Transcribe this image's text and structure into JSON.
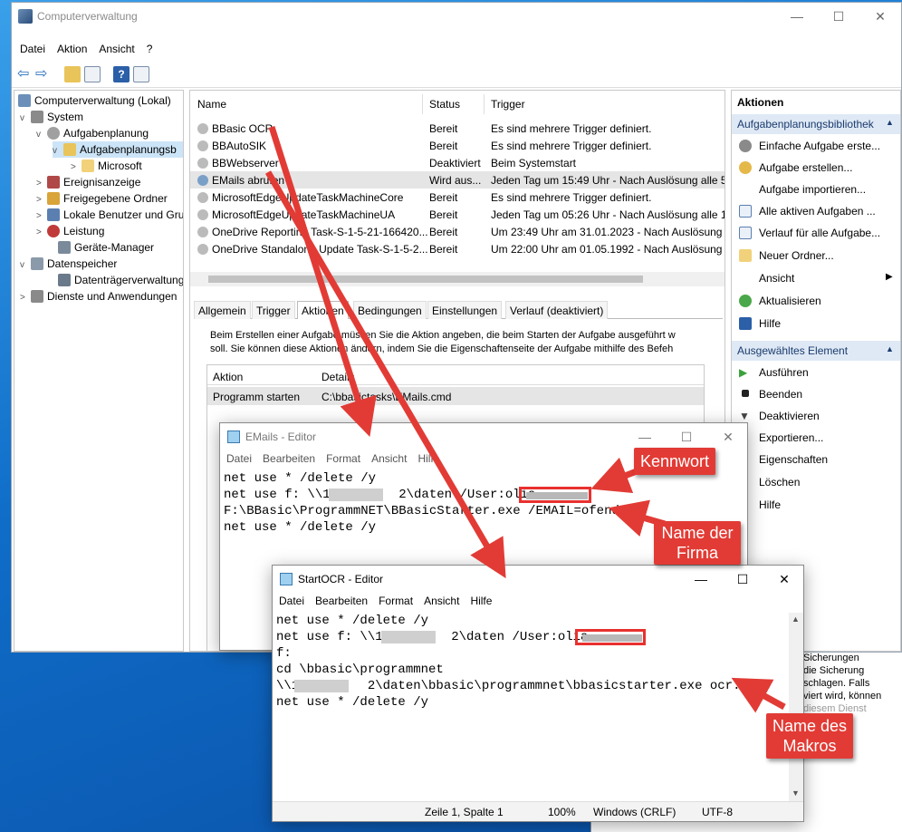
{
  "main": {
    "title": "Computerverwaltung",
    "controls": {
      "minimize": "—",
      "maximize": "☐",
      "close": "✕"
    },
    "menu": [
      "Datei",
      "Aktion",
      "Ansicht",
      "?"
    ]
  },
  "tree": [
    {
      "label": "Computerverwaltung (Lokal)",
      "exp": ""
    },
    {
      "label": "System",
      "exp": "v"
    },
    {
      "label": "Aufgabenplanung",
      "exp": "v"
    },
    {
      "label": "Aufgabenplanungsb",
      "exp": "v"
    },
    {
      "label": "Microsoft",
      "exp": ">"
    },
    {
      "label": "Ereignisanzeige",
      "exp": ">"
    },
    {
      "label": "Freigegebene Ordner",
      "exp": ">"
    },
    {
      "label": "Lokale Benutzer und Gru",
      "exp": ">"
    },
    {
      "label": "Leistung",
      "exp": ">"
    },
    {
      "label": "Geräte-Manager",
      "exp": ""
    },
    {
      "label": "Datenspeicher",
      "exp": "v"
    },
    {
      "label": "Datenträgerverwaltung",
      "exp": ""
    },
    {
      "label": "Dienste und Anwendungen",
      "exp": ">"
    }
  ],
  "tasks": {
    "columns": [
      "Name",
      "Status",
      "Trigger"
    ],
    "rows": [
      {
        "name": "BBasic OCR",
        "status": "Bereit",
        "trigger": "Es sind mehrere Trigger definiert."
      },
      {
        "name": "BBAutoSIK",
        "status": "Bereit",
        "trigger": "Es sind mehrere Trigger definiert."
      },
      {
        "name": "BBWebserver",
        "status": "Deaktiviert",
        "trigger": "Beim Systemstart"
      },
      {
        "name": "EMails abrufen",
        "status": "Wird aus...",
        "trigger": "Jeden Tag um 15:49 Uhr - Nach Auslösung alle 5"
      },
      {
        "name": "MicrosoftEdgeUpdateTaskMachineCore",
        "status": "Bereit",
        "trigger": "Es sind mehrere Trigger definiert."
      },
      {
        "name": "MicrosoftEdgeUpdateTaskMachineUA",
        "status": "Bereit",
        "trigger": "Jeden Tag um 05:26 Uhr - Nach Auslösung alle 1"
      },
      {
        "name": "OneDrive Reporting Task-S-1-5-21-166420...",
        "status": "Bereit",
        "trigger": "Um 23:49 Uhr am 31.01.2023 - Nach Auslösung a"
      },
      {
        "name": "OneDrive Standalone Update Task-S-1-5-2...",
        "status": "Bereit",
        "trigger": "Um 22:00 Uhr am 01.05.1992 - Nach Auslösung a"
      }
    ]
  },
  "detail_tabs": [
    "Allgemein",
    "Trigger",
    "Aktionen",
    "Bedingungen",
    "Einstellungen",
    "Verlauf (deaktiviert)"
  ],
  "detail": {
    "text1": "Beim Erstellen einer Aufgabe müssen Sie die Aktion angeben, die beim Starten der Aufgabe ausgeführt w",
    "text2": "soll. Sie können diese Aktionen ändern, indem Sie die Eigenschaftenseite der Aufgabe mithilfe des Befeh",
    "col_action": "Aktion",
    "col_details": "Details",
    "row_action": "Programm starten",
    "row_details": "C:\\bbasictasks\\EMails.cmd"
  },
  "actions_pane": {
    "header": "Aktionen",
    "section1": "Aufgabenplanungsbibliothek",
    "items1": [
      "Einfache Aufgabe erste...",
      "Aufgabe erstellen...",
      "Aufgabe importieren...",
      "Alle aktiven Aufgaben ...",
      "Verlauf für alle Aufgabe...",
      "Neuer Ordner...",
      "Ansicht",
      "Aktualisieren",
      "Hilfe"
    ],
    "section2": "Ausgewähltes Element",
    "items2": [
      "Ausführen",
      "Beenden",
      "Deaktivieren",
      "Exportieren...",
      "Eigenschaften",
      "Löschen",
      "Hilfe"
    ]
  },
  "behind_text": [
    "Sicherungen",
    "die Sicherung",
    "schlagen. Falls",
    "viert wird, können",
    "diesem Dienst"
  ],
  "editor1": {
    "title": "EMails - Editor",
    "menu": [
      "Datei",
      "Bearbeiten",
      "Format",
      "Ansicht",
      "Hilfe"
    ],
    "lines": [
      "net use * /delete /y",
      "net use f: \\\\10        2\\daten /User:olia",
      "F:\\BBasic\\ProgrammNET\\BBasicStarter.exe /EMAIL=ofendt",
      "net use * /delete /y"
    ]
  },
  "editor2": {
    "title": "StartOCR - Editor",
    "menu": [
      "Datei",
      "Bearbeiten",
      "Format",
      "Ansicht",
      "Hilfe"
    ],
    "lines": [
      "net use * /delete /y",
      "net use f: \\\\10        2\\daten /User:olia",
      "f:",
      "cd \\bbasic\\programmnet",
      "\\\\10        2\\daten\\bbasic\\programmnet\\bbasicstarter.exe ocr.BBS",
      "net use * /delete /y"
    ],
    "status": {
      "pos": "Zeile 1, Spalte 1",
      "zoom": "100%",
      "eol": "Windows (CRLF)",
      "enc": "UTF-8"
    }
  },
  "callouts": {
    "kennwort": "Kennwort",
    "firma_l1": "Name der",
    "firma_l2": "Firma",
    "makro_l1": "Name des",
    "makro_l2": "Makros"
  },
  "colors": {
    "accent": "#e8312f",
    "callout": "#e23b35",
    "selection": "#cce4f7",
    "section": "#dfe9f5"
  }
}
